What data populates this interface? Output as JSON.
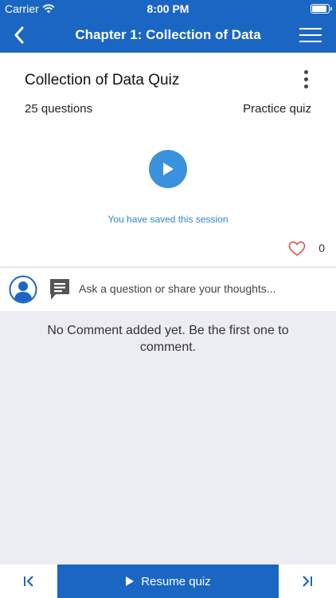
{
  "status_bar": {
    "carrier": "Carrier",
    "time": "8:00 PM"
  },
  "nav": {
    "title": "Chapter 1: Collection of Data"
  },
  "quiz": {
    "title": "Collection of Data Quiz",
    "question_count": "25 questions",
    "quiz_type": "Practice quiz",
    "saved_note": "You have saved this session",
    "like_count": "0"
  },
  "comments": {
    "placeholder": "Ask a question or share your thoughts...",
    "empty_note": "No Comment added yet. Be the first one to comment."
  },
  "bottom_bar": {
    "resume_label": "Resume quiz"
  },
  "colors": {
    "brand": "#1a66c2",
    "play": "#3a91dd",
    "heart": "#e0514f",
    "link": "#2f86d1"
  }
}
